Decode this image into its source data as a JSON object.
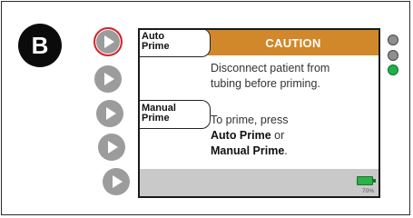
{
  "panel_label": "B",
  "soft_keys": {
    "auto_prime": [
      "Auto",
      "Prime"
    ],
    "manual_prime": [
      "Manual",
      "Prime"
    ]
  },
  "screen": {
    "header": "CAUTION",
    "message_line1": "Disconnect patient from",
    "message_line2": "tubing before priming.",
    "instruction_line1": "To prime, press",
    "instruction_auto": "Auto Prime",
    "instruction_or": " or",
    "instruction_manual": "Manual Prime",
    "instruction_end": "."
  },
  "battery": {
    "level_percent": 70,
    "label": "70%"
  },
  "indicator_colors": {
    "top": "#8f8f8f",
    "middle": "#8f8f8f",
    "bottom": "#1bb34a",
    "caution_bar": "#d1882a",
    "highlight_ring": "#d6242b"
  },
  "side_buttons": [
    {
      "name": "side-button-1",
      "highlighted": true
    },
    {
      "name": "side-button-2",
      "highlighted": false
    },
    {
      "name": "side-button-3",
      "highlighted": false
    },
    {
      "name": "side-button-4",
      "highlighted": false
    },
    {
      "name": "side-button-5",
      "highlighted": false
    }
  ]
}
